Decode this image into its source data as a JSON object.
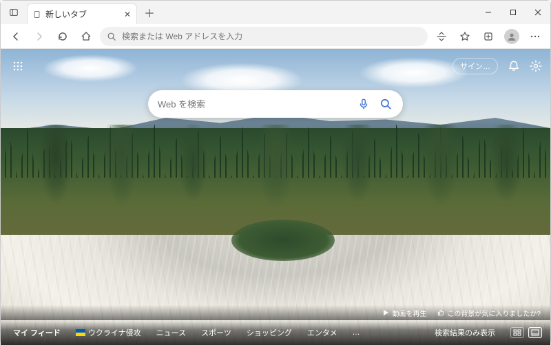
{
  "window": {
    "title": "新しいタブ"
  },
  "toolbar": {
    "omnibox_placeholder": "検索または Web アドレスを入力"
  },
  "ntp": {
    "search_placeholder": "Web を検索",
    "signin_label": "サイン…",
    "play_label": "動画を再生",
    "like_label": "この背景が気に入りましたか?"
  },
  "feed": {
    "title": "マイ フィード",
    "items": [
      "ウクライナ侵攻",
      "ニュース",
      "スポーツ",
      "ショッピング",
      "エンタメ"
    ],
    "more": "…",
    "layout_label": "検索結果のみ表示"
  }
}
